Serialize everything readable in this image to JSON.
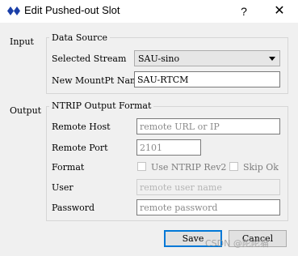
{
  "window": {
    "title": "Edit Pushed-out Slot",
    "help_glyph": "?",
    "close_glyph": "✕",
    "icon": "double-diamond-icon",
    "accent_color": "#0078d7"
  },
  "input": {
    "section_label": "Input",
    "group_title": "Data Source",
    "stream_label": "Selected Stream",
    "stream_value": "SAU-sino",
    "mountpt_label": "New MountPt Name",
    "mountpt_value": "SAU-RTCM"
  },
  "output": {
    "section_label": "Output",
    "group_title": "NTRIP Output Format",
    "host_label": "Remote Host",
    "host_placeholder": "remote URL or IP",
    "port_label": "Remote Port",
    "port_value": "2101",
    "format_label": "Format",
    "ntrip_rev2_label": "Use NTRIP Rev2",
    "ntrip_rev2_checked": false,
    "skip_ok_label": "Skip Ok",
    "skip_ok_checked": false,
    "user_label": "User",
    "user_placeholder": "remote user name",
    "password_label": "Password",
    "password_placeholder": "remote password"
  },
  "buttons": {
    "save": "Save",
    "cancel": "Cancel"
  },
  "watermark": "CSDN @陀陀猫"
}
